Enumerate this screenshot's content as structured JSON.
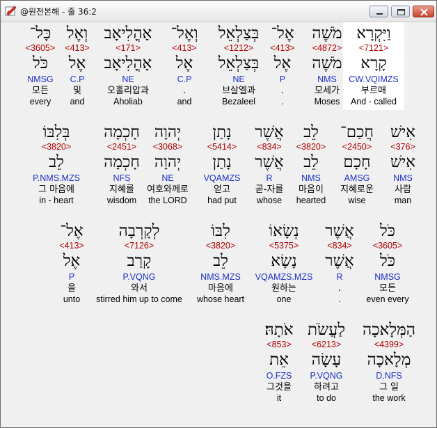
{
  "window": {
    "title": "@원전본해 - 줄 36:2"
  },
  "lines": [
    [
      {
        "heb": "וַיִּקְרָא",
        "strong": "<7121>",
        "lemma": "קָרָא",
        "morph": "CW.VQIMZS",
        "ko": "부르매",
        "en": "And - called",
        "highlight": true
      },
      {
        "heb": "מֹשֶׁה",
        "strong": "<4872>",
        "lemma": "מֹשֶׁה",
        "morph": "NMS",
        "ko": "모세가",
        "en": "Moses"
      },
      {
        "heb": "אֶל־",
        "strong": "<413>",
        "lemma": "אֶל",
        "morph": "P",
        "ko": ".",
        "en": "."
      },
      {
        "heb": "בְּצַלְאֵל",
        "strong": "<1212>",
        "lemma": "בְּצַלְאֵל",
        "morph": "NE",
        "ko": "브살엘과",
        "en": "Bezaleel"
      },
      {
        "heb": "וְאֶל־",
        "strong": "<413>",
        "lemma": "אֶל",
        "morph": "C.P",
        "ko": ".",
        "en": "and"
      },
      {
        "heb": "אָהֳלִיאָב",
        "strong": "<171>",
        "lemma": "אָהֳלִיאָב",
        "morph": "NE",
        "ko": "오홀리압과",
        "en": "Aholiab"
      },
      {
        "heb": "וְאֶל",
        "strong": "<413>",
        "lemma": "אֶל",
        "morph": "C.P",
        "ko": "및",
        "en": "and"
      },
      {
        "heb": "כָּל־",
        "strong": "<3605>",
        "lemma": "כֹּל",
        "morph": "NMSG",
        "ko": "모든",
        "en": "every"
      }
    ],
    [
      {
        "heb": "אִישׁ",
        "strong": "<376>",
        "lemma": "אִישׁ",
        "morph": "NMS",
        "ko": "사람",
        "en": "man"
      },
      {
        "heb": "חֲכַם־",
        "strong": "<2450>",
        "lemma": "חָכָם",
        "morph": "AMSG",
        "ko": "지혜로운",
        "en": "wise"
      },
      {
        "heb": "לֵב",
        "strong": "<3820>",
        "lemma": "לֵב",
        "morph": "NMS",
        "ko": "마음이",
        "en": "hearted"
      },
      {
        "heb": "אֲשֶׁר",
        "strong": "<834>",
        "lemma": "אֲשֶׁר",
        "morph": "R",
        "ko": "곧-자를",
        "en": "whose"
      },
      {
        "heb": "נָתַן",
        "strong": "<5414>",
        "lemma": "נָתַן",
        "morph": "VQAMZS",
        "ko": "얻고",
        "en": "had put"
      },
      {
        "heb": "יְהוָה",
        "strong": "<3068>",
        "lemma": "יְהוָה",
        "morph": "NE",
        "ko": "여호와께로",
        "en": "the LORD"
      },
      {
        "heb": "חָכְמָה",
        "strong": "<2451>",
        "lemma": "חָכְמָה",
        "morph": "NFS",
        "ko": "지혜를",
        "en": "wisdom"
      },
      {
        "heb": "בְּלִבּוֹ",
        "strong": "<3820>",
        "lemma": "לֵב",
        "morph": "P.NMS.MZS",
        "ko": "그 마음에",
        "en": "in - heart"
      }
    ],
    [
      {
        "heb": "כֹּל",
        "strong": "<3605>",
        "lemma": "כֹּל",
        "morph": "NMSG",
        "ko": "모든",
        "en": "even every"
      },
      {
        "heb": "אֲשֶׁר",
        "strong": "<834>",
        "lemma": "אֲשֶׁר",
        "morph": "R",
        "ko": ".",
        "en": "."
      },
      {
        "heb": "נְשָׂאוֹ",
        "strong": "<5375>",
        "lemma": "נָשָׂא",
        "morph": "VQAMZS.MZS",
        "ko": "원하는",
        "en": "one"
      },
      {
        "heb": "לִבּוֹ",
        "strong": "<3820>",
        "lemma": "לֵב",
        "morph": "NMS.MZS",
        "ko": "마음에",
        "en": "whose heart"
      },
      {
        "heb": "לְקָרְבָה",
        "strong": "<7126>",
        "lemma": "קָרַב",
        "morph": "P.VQNG",
        "ko": "와서",
        "en": "stirred him up to come"
      },
      {
        "heb": "אֶל־",
        "strong": "<413>",
        "lemma": "אֶל",
        "morph": "P",
        "ko": "을",
        "en": "unto"
      }
    ],
    [
      {
        "heb": "הַמְּלָאכָה",
        "strong": "<4399>",
        "lemma": "מְלָאכָה",
        "morph": "D.NFS",
        "ko": "그 일",
        "en": "the work"
      },
      {
        "heb": "לַעֲשֹׂת",
        "strong": "<6213>",
        "lemma": "עָשָׂה",
        "morph": "P.VQNG",
        "ko": "하려고",
        "en": "to do"
      },
      {
        "heb": "אֹתָהּ׃",
        "strong": "<853>",
        "lemma": "אֵת",
        "morph": "O.FZS",
        "ko": "그것을",
        "en": "it"
      }
    ]
  ]
}
